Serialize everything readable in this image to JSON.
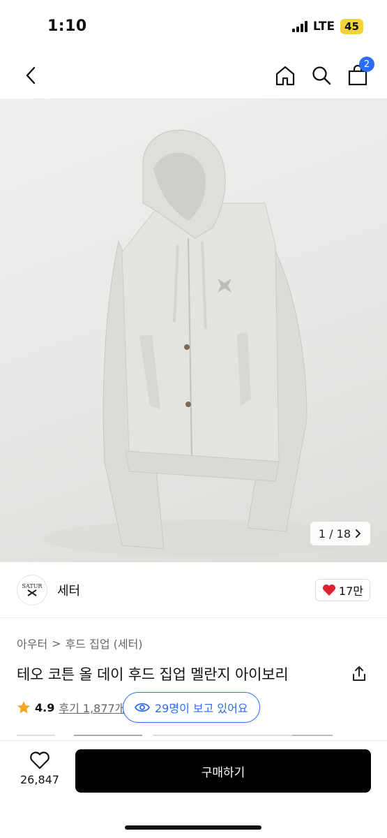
{
  "status_bar": {
    "time": "1:10",
    "network": "LTE",
    "battery": "45"
  },
  "nav": {
    "cart_count": "2"
  },
  "gallery": {
    "counter": "1 / 18"
  },
  "brand": {
    "logo_text": "SATUR",
    "name": "세터"
  },
  "likes": {
    "count": "17만"
  },
  "breadcrumb": {
    "level1": "아우터",
    "separator": ">",
    "level2": "후드 집업 (세터)"
  },
  "product": {
    "title": "테오 코튼 올 데이 후드 집업 멜란지 아이보리"
  },
  "rating": {
    "score": "4.9",
    "reviews_label": "후기 1,877개"
  },
  "viewers": {
    "label": "29명이 보고 있어요"
  },
  "bottom_bar": {
    "wish_count": "26,847",
    "buy_label": "구매하기"
  },
  "colors": {
    "accent": "#2d6cf6",
    "heart": "#e0202f",
    "star": "#f5a524",
    "buy_bg": "#000000"
  }
}
